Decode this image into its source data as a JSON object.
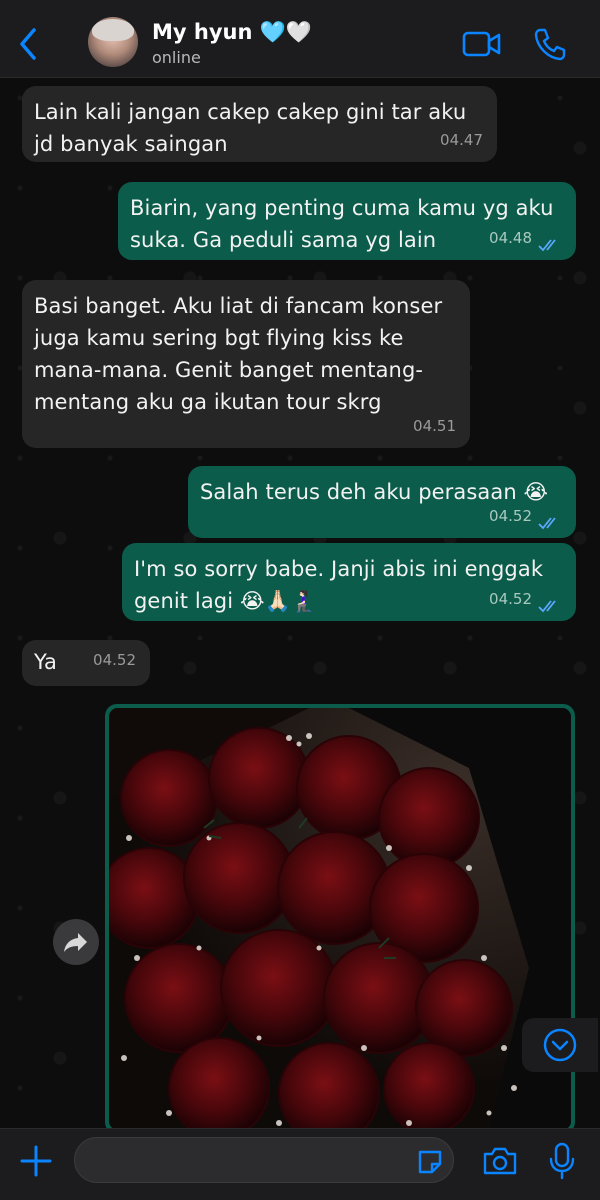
{
  "header": {
    "contact_name": "My hyun 🩵🤍",
    "status": "online"
  },
  "messages": [
    {
      "id": "m1",
      "direction": "incoming",
      "text": "Lain kali jangan cakep cakep gini tar aku jd banyak saingan",
      "time": "04.47"
    },
    {
      "id": "m2",
      "direction": "outgoing",
      "text": "Biarin, yang penting cuma kamu yg aku suka. Ga peduli sama yg lain",
      "time": "04.48",
      "status": "read"
    },
    {
      "id": "m3",
      "direction": "incoming",
      "text": "Basi banget. Aku liat di fancam konser juga kamu sering bgt flying kiss ke mana-mana. Genit banget mentang-mentang aku ga ikutan tour skrg",
      "time": "04.51"
    },
    {
      "id": "m4",
      "direction": "outgoing",
      "text": "Salah terus deh aku perasaan 😭",
      "time": "04.52",
      "status": "read"
    },
    {
      "id": "m5",
      "direction": "outgoing",
      "text": "I'm so sorry babe. Janji abis ini enggak genit lagi 😭🙏🏻🧎🏻‍♀️",
      "time": "04.52",
      "status": "read"
    },
    {
      "id": "m6",
      "direction": "incoming",
      "text": "Ya",
      "time": "04.52"
    }
  ],
  "composer": {
    "value": "",
    "placeholder": ""
  },
  "icons": {
    "back": "chevron-left-icon",
    "video": "video-camera-icon",
    "call": "phone-icon",
    "forward": "forward-arrow-icon",
    "scroll_down": "chevron-down-circle-icon",
    "plus": "plus-icon",
    "sticker": "sticker-icon",
    "camera": "camera-icon",
    "mic": "microphone-icon"
  },
  "colors": {
    "accent": "#0a84ff",
    "outgoing_bubble": "#0b5c4b",
    "incoming_bubble": "#262626",
    "read_ticks": "#5aa8ff"
  }
}
